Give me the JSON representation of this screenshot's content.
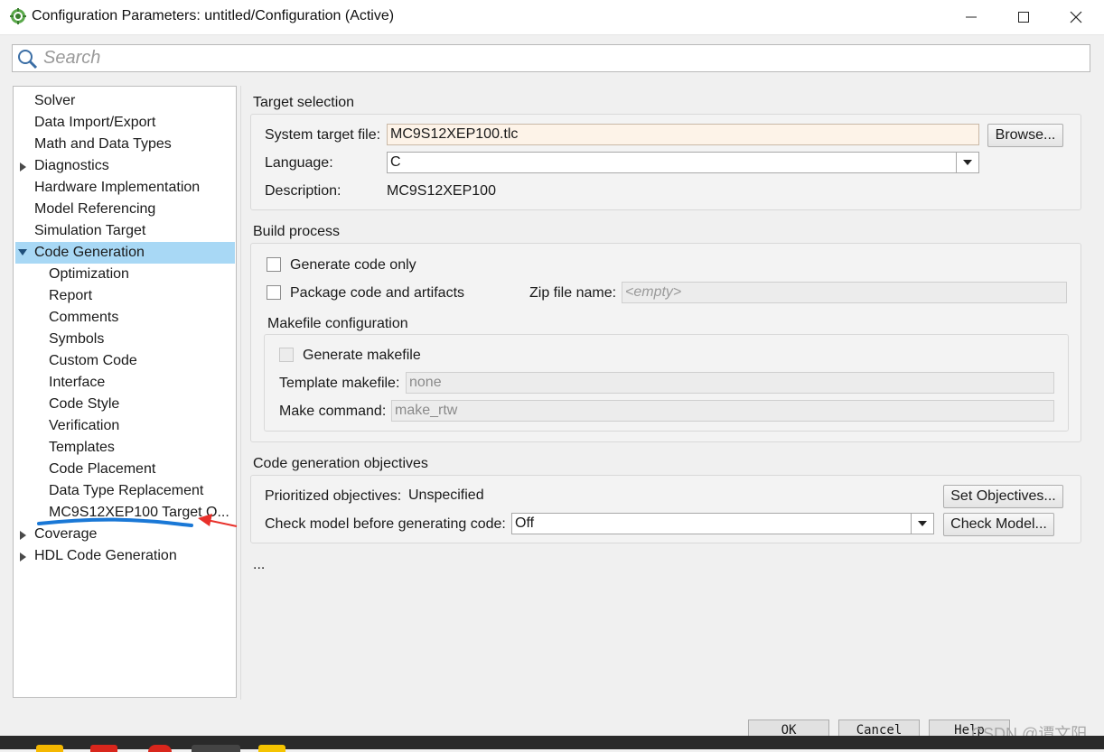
{
  "window": {
    "title": "Configuration Parameters: untitled/Configuration (Active)"
  },
  "search": {
    "placeholder": "Search"
  },
  "tree": {
    "items": [
      {
        "label": "Solver"
      },
      {
        "label": "Data Import/Export"
      },
      {
        "label": "Math and Data Types"
      },
      {
        "label": "Diagnostics"
      },
      {
        "label": "Hardware Implementation"
      },
      {
        "label": "Model Referencing"
      },
      {
        "label": "Simulation Target"
      },
      {
        "label": "Code Generation"
      },
      {
        "label": "Optimization"
      },
      {
        "label": "Report"
      },
      {
        "label": "Comments"
      },
      {
        "label": "Symbols"
      },
      {
        "label": "Custom Code"
      },
      {
        "label": "Interface"
      },
      {
        "label": "Code Style"
      },
      {
        "label": "Verification"
      },
      {
        "label": "Templates"
      },
      {
        "label": "Code Placement"
      },
      {
        "label": "Data Type Replacement"
      },
      {
        "label": "MC9S12XEP100 Target O..."
      },
      {
        "label": "Coverage"
      },
      {
        "label": "HDL Code Generation"
      }
    ],
    "selected": "Code Generation"
  },
  "target_selection": {
    "title": "Target selection",
    "system_target_file_label": "System target file:",
    "system_target_file_value": "MC9S12XEP100.tlc",
    "browse_label": "Browse...",
    "language_label": "Language:",
    "language_value": "C",
    "description_label": "Description:",
    "description_value": "MC9S12XEP100"
  },
  "build_process": {
    "title": "Build process",
    "generate_code_only_label": "Generate code only",
    "package_code_label": "Package code and artifacts",
    "zip_file_label": "Zip file name:",
    "zip_file_placeholder": "<empty>",
    "makefile_config_title": "Makefile configuration",
    "generate_makefile_label": "Generate makefile",
    "template_makefile_label": "Template makefile:",
    "template_makefile_value": "none",
    "make_command_label": "Make command:",
    "make_command_value": "make_rtw"
  },
  "objectives": {
    "title": "Code generation objectives",
    "prioritized_label": "Prioritized objectives:",
    "prioritized_value": "Unspecified",
    "set_objectives_label": "Set Objectives...",
    "check_model_label": "Check model before generating code:",
    "check_model_value": "Off",
    "check_model_button_label": "Check Model..."
  },
  "misc": {
    "ellipsis": "..."
  },
  "footer": {
    "ok_label": "OK",
    "cancel_label": "Cancel",
    "help_label": "Help"
  },
  "watermark": "CSDN @谭文阳",
  "colors": {
    "selection": "#a8d8f5",
    "highlight_field": "#fdf3e8",
    "annotation_blue": "#1a78d6",
    "annotation_red": "#e8302a"
  }
}
